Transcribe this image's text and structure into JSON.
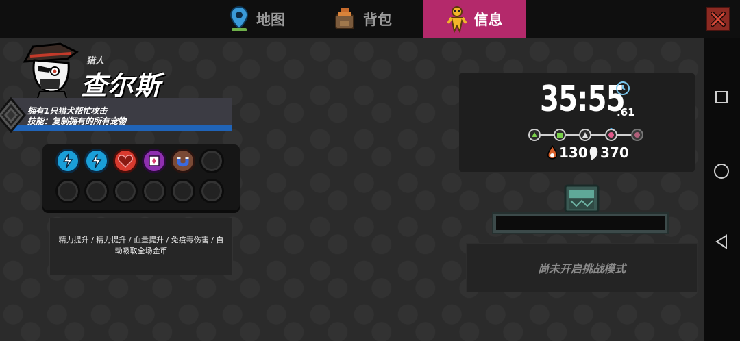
{
  "tabs": [
    {
      "label": "地图",
      "icon": "map-pin-icon",
      "active": false
    },
    {
      "label": "背包",
      "icon": "backpack-icon",
      "active": false
    },
    {
      "label": "信息",
      "icon": "info-person-icon",
      "active": true
    }
  ],
  "character": {
    "role": "猎人",
    "name": "查尔斯",
    "desc_line1": "拥有1只猎犬帮忙攻击",
    "desc_line2": "技能：复制拥有的所有宠物"
  },
  "buffs": {
    "slots": [
      {
        "icon": "energy-up-icon",
        "color": "#1a9fd8"
      },
      {
        "icon": "energy-up-icon",
        "color": "#1a9fd8"
      },
      {
        "icon": "health-up-icon",
        "color": "#d83a2e"
      },
      {
        "icon": "poison-immune-icon",
        "color": "#8e2fb0"
      },
      {
        "icon": "coin-magnet-icon",
        "color": "#7a4a36"
      },
      {
        "icon": "empty-slot",
        "color": "#222222"
      },
      {
        "icon": "empty-slot",
        "color": "#222222"
      },
      {
        "icon": "empty-slot",
        "color": "#222222"
      },
      {
        "icon": "empty-slot",
        "color": "#222222"
      },
      {
        "icon": "empty-slot",
        "color": "#222222"
      },
      {
        "icon": "empty-slot",
        "color": "#222222"
      },
      {
        "icon": "empty-slot",
        "color": "#222222"
      }
    ],
    "summary": "精力提升 / 精力提升 / 血量提升 / 免疫毒伤害 / 自动吸取全场金币"
  },
  "run": {
    "time": "35:55",
    "time_fraction": ".61",
    "enemies_killed": "130",
    "souls": "370",
    "challenge_text": "尚未开启挑战模式"
  },
  "colors": {
    "active_tab": "#b4296b",
    "progress_blue": "#2064b8",
    "close_red": "#8c2a22"
  }
}
